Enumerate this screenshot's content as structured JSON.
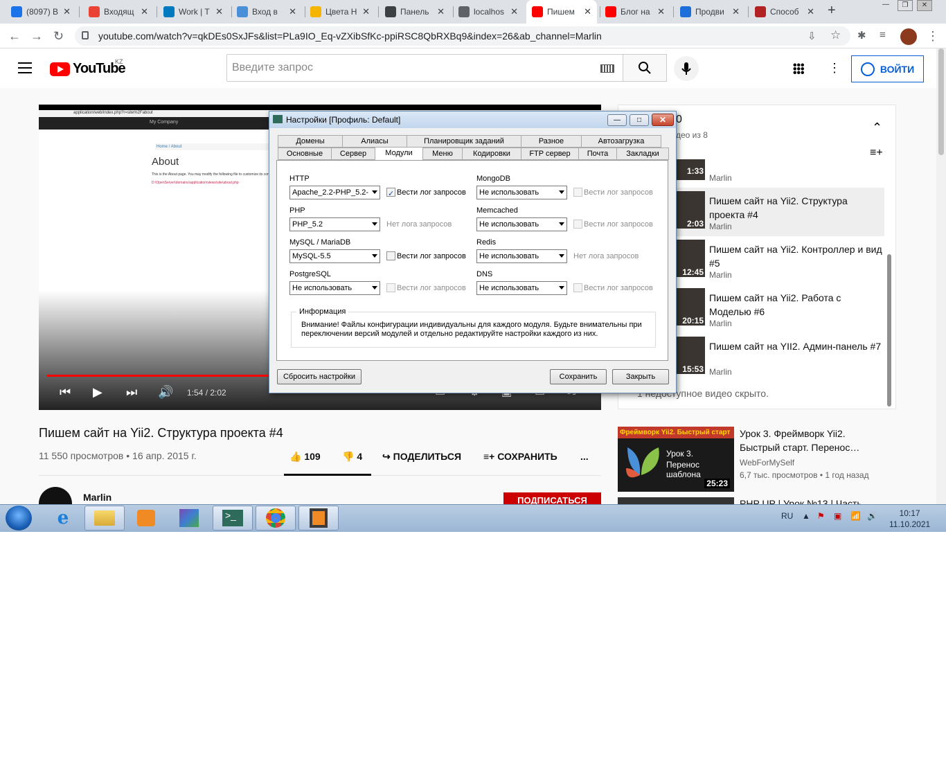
{
  "browser": {
    "tabs": [
      {
        "title": "(8097) В",
        "color": "#1a73e8"
      },
      {
        "title": "Входящ",
        "color": "#ea4335"
      },
      {
        "title": "Work | T",
        "color": "#0079bf"
      },
      {
        "title": "Вход в",
        "color": "#4a90d9"
      },
      {
        "title": "Цвета Н",
        "color": "#f4b400"
      },
      {
        "title": "Панель",
        "color": "#3c4043"
      },
      {
        "title": "localhos",
        "color": "#5f6368"
      },
      {
        "title": "Пишем",
        "color": "#ff0000"
      },
      {
        "title": "Блог на",
        "color": "#ff0000"
      },
      {
        "title": "Продви",
        "color": "#1e6fd9"
      },
      {
        "title": "Способ",
        "color": "#b22222"
      }
    ],
    "new_tab": "+",
    "url": "youtube.com/watch?v=qkDEs0SxJFs&list=PLa9IO_Eq-vZXibSfKc-ppiRSC8QbRXBq9&index=26&ab_channel=Marlin"
  },
  "youtube": {
    "logo": "YouTube",
    "region": "KZ",
    "search_placeholder": "Введите запрос",
    "signin": "ВОЙТИ",
    "video": {
      "inner_url": "application/web/index.php?r=site%2Fabout",
      "inner_brand": "My Company",
      "inner_breadcrumb": "Home  /  About",
      "inner_heading": "About",
      "inner_text": "This is the About page. You may modify the following file to customize its content:",
      "inner_path": "D:\\OpenServer\\domains\\application\\views\\site\\about.php",
      "progress": 0.927,
      "time": "1:54 / 2:02"
    },
    "title": "Пишем сайт на Yii2. Структура проекта #4",
    "views": "11 550 просмотров • 16 апр. 2015 г.",
    "likes": "109",
    "dislikes": "4",
    "share": "ПОДЕЛИТЬСЯ",
    "save": "СОХРАНИТЬ",
    "more": "...",
    "channel": "Marlin",
    "subscribe": "ПОДПИСАТЬСЯ",
    "playlist": {
      "header_fragment": "0",
      "count": "део из 8",
      "items": [
        {
          "duration": "1:33",
          "title": "",
          "channel": "Marlin"
        },
        {
          "duration": "2:03",
          "title": "Пишем сайт на Yii2. Структура проекта #4",
          "channel": "Marlin"
        },
        {
          "duration": "12:45",
          "title": "Пишем сайт на Yii2. Контроллер и вид #5",
          "channel": "Marlin"
        },
        {
          "duration": "20:15",
          "title": "Пишем сайт на Yii2. Работа с Моделью #6",
          "channel": "Marlin"
        },
        {
          "duration": "15:53",
          "title": "Пишем сайт на YII2. Админ-панель #7",
          "channel": "Marlin"
        }
      ],
      "hidden_note": "1 недоступное видео скрыто."
    },
    "recommended": [
      {
        "thumb_label": "Фреймворк Yii2. Быстрый старт",
        "thumb_line1": "Урок 3.",
        "thumb_line2": "Перенос шаблона",
        "duration": "25:23",
        "title": "Урок 3. Фреймворк Yii2. Быстрый старт. Перенос…",
        "channel": "WebForMySelf",
        "meta": "6,7 тыс. просмотров • 1 год назад"
      },
      {
        "title": "PHP UP | Урок №13 | Часть"
      }
    ]
  },
  "dialog": {
    "title": "Настройки [Профиль: Default]",
    "tabs_row1": [
      "Домены",
      "Алиасы",
      "Планировщик заданий",
      "Разное",
      "Автозагрузка"
    ],
    "tabs_row2": [
      "Основные",
      "Сервер",
      "Модули",
      "Меню",
      "Кодировки",
      "FTP сервер",
      "Почта",
      "Закладки"
    ],
    "active_tab": "Модули",
    "modules": {
      "http": {
        "label": "HTTP",
        "value": "Apache_2.2-PHP_5.2-",
        "log": "Вести лог запросов"
      },
      "php": {
        "label": "PHP",
        "value": "PHP_5.2",
        "log": "Нет лога запросов"
      },
      "mysql": {
        "label": "MySQL / MariaDB",
        "value": "MySQL-5.5",
        "log": "Вести лог запросов"
      },
      "pgsql": {
        "label": "PostgreSQL",
        "value": "Не использовать",
        "log": "Вести лог запросов"
      },
      "mongo": {
        "label": "MongoDB",
        "value": "Не использовать",
        "log": "Вести лог запросов"
      },
      "memcached": {
        "label": "Memcached",
        "value": "Не использовать",
        "log": "Вести лог запросов"
      },
      "redis": {
        "label": "Redis",
        "value": "Не использовать",
        "log": "Нет лога запросов"
      },
      "dns": {
        "label": "DNS",
        "value": "Не использовать",
        "log": "Вести лог запросов"
      }
    },
    "info_label": "Информация",
    "info_text": "Внимание! Файлы конфигурации индивидуальны для каждого модуля. Будьте внимательны при переключении версий модулей и отдельно редактируйте настройки каждого из них.",
    "reset": "Сбросить настройки",
    "save": "Сохранить",
    "close": "Закрыть"
  },
  "taskbar": {
    "lang": "RU",
    "time": "10:17",
    "date": "11.10.2021"
  }
}
